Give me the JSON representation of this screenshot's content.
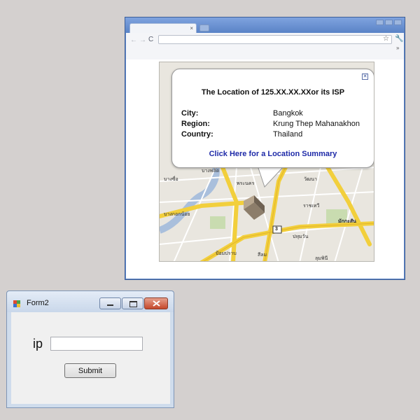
{
  "browser": {
    "tab_close_glyph": "×",
    "nav": {
      "back": "←",
      "forward": "→",
      "reload": "C"
    },
    "address_value": "",
    "star_glyph": "☆",
    "wrench_glyph": "🔧",
    "chevron_glyph": "»"
  },
  "map": {
    "labels": [
      "บางซื่อ",
      "บางพลัด",
      "พระนคร",
      "ป้อมปราบ",
      "วัฒนา",
      "ราชเทวี",
      "บางกอกน้อย",
      "มักกะสัน",
      "ลุมพินี",
      "ปทุมวัน",
      "สีลม"
    ],
    "road_marker": "3"
  },
  "popup": {
    "close_glyph": "✕",
    "title": "The Location of 125.XX.XX.XXor its ISP",
    "rows": [
      {
        "label": "City:",
        "value": "Bangkok"
      },
      {
        "label": "Region:",
        "value": "Krung Thep Mahanakhon"
      },
      {
        "label": "Country:",
        "value": "Thailand"
      }
    ],
    "link": "Click Here for a Location Summary"
  },
  "form2": {
    "title": "Form2",
    "ip_label": "ip",
    "ip_value": "",
    "submit_label": "Submit"
  },
  "colors": {
    "link": "#1e2aa8",
    "road_major": "#f2cf3c",
    "map_bg": "#e9e6df"
  }
}
